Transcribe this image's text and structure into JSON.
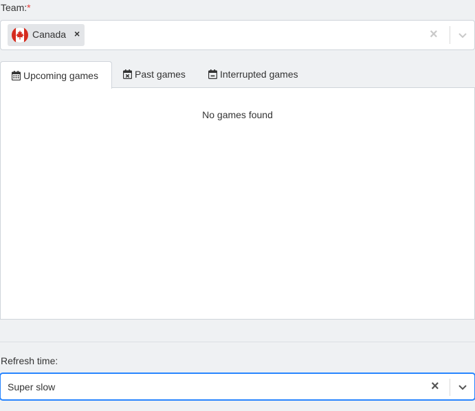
{
  "team": {
    "label": "Team:",
    "required_marker": "*",
    "selected": [
      {
        "label": "Canada",
        "flag_icon": "canada-flag-icon"
      }
    ],
    "remove_glyph": "×",
    "clear_glyph": "×"
  },
  "tabs": [
    {
      "label": "Upcoming games",
      "icon": "calendar-icon",
      "active": true
    },
    {
      "label": "Past games",
      "icon": "calendar-x-icon",
      "active": false
    },
    {
      "label": "Interrupted games",
      "icon": "calendar-minus-icon",
      "active": false
    }
  ],
  "panel": {
    "empty_message": "No games found"
  },
  "refresh": {
    "label": "Refresh time:",
    "value": "Super slow",
    "clear_glyph": "×"
  },
  "colors": {
    "focus_border": "#2684ff",
    "required": "#e53935",
    "canada_red": "#d52b1e"
  }
}
